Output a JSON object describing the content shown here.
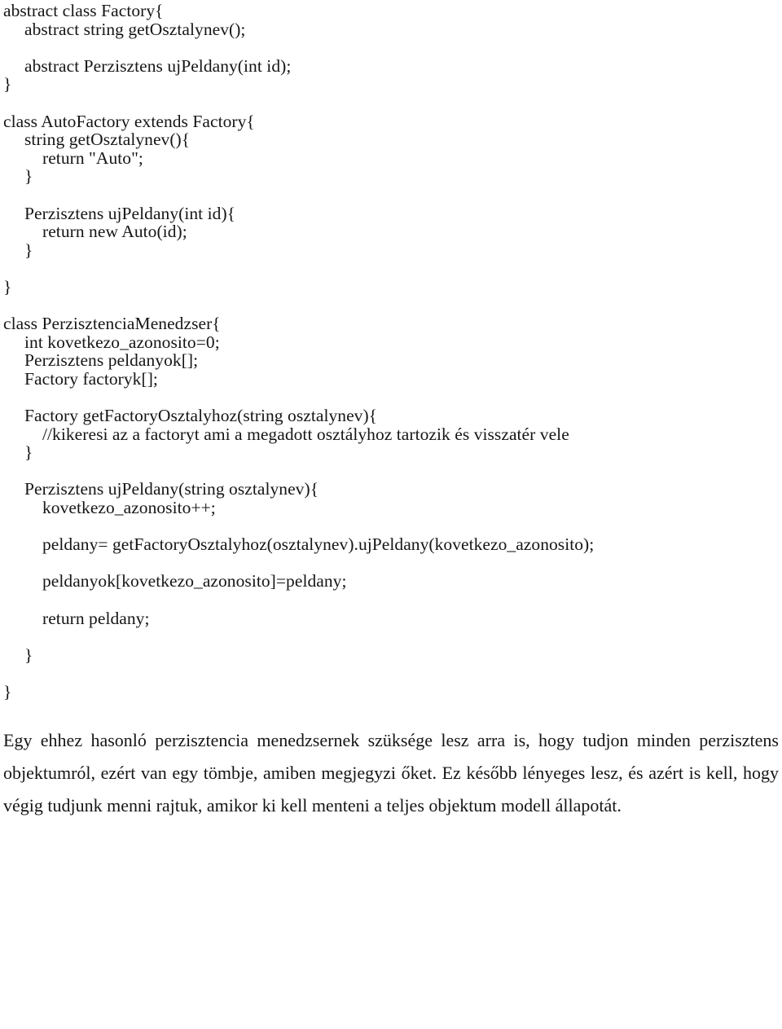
{
  "document": {
    "type": "scanned-text-page",
    "language": "hu",
    "background_color": "#ffffff",
    "text_color": "#161616"
  },
  "code_listing": {
    "language": "java-like pseudocode",
    "lines": [
      {
        "indent": 0,
        "text": "abstract class Factory{"
      },
      {
        "indent": 1,
        "text": "abstract string getOsztalynev();"
      },
      {
        "indent": 0,
        "text": ""
      },
      {
        "indent": 1,
        "text": "abstract Perzisztens ujPeldany(int id);"
      },
      {
        "indent": 0,
        "text": "}"
      },
      {
        "indent": 0,
        "text": ""
      },
      {
        "indent": 0,
        "text": "class AutoFactory extends Factory{"
      },
      {
        "indent": 1,
        "text": "string getOsztalynev(){"
      },
      {
        "indent": 2,
        "text": "return \"Auto\";"
      },
      {
        "indent": 1,
        "text": "}"
      },
      {
        "indent": 0,
        "text": ""
      },
      {
        "indent": 1,
        "text": "Perzisztens ujPeldany(int id){"
      },
      {
        "indent": 2,
        "text": "return new Auto(id);"
      },
      {
        "indent": 1,
        "text": "}"
      },
      {
        "indent": 0,
        "text": ""
      },
      {
        "indent": 0,
        "text": "}"
      },
      {
        "indent": 0,
        "text": ""
      },
      {
        "indent": 0,
        "text": "class PerzisztenciaMenedzser{"
      },
      {
        "indent": 1,
        "text": "int kovetkezo_azonosito=0;"
      },
      {
        "indent": 1,
        "text": "Perzisztens peldanyok[];"
      },
      {
        "indent": 1,
        "text": "Factory factoryk[];"
      },
      {
        "indent": 0,
        "text": ""
      },
      {
        "indent": 1,
        "text": "Factory getFactoryOsztalyhoz(string osztalynev){"
      },
      {
        "indent": 2,
        "text": "//kikeresi az a factoryt ami a megadott osztályhoz tartozik és visszatér vele"
      },
      {
        "indent": 1,
        "text": "}"
      },
      {
        "indent": 0,
        "text": ""
      },
      {
        "indent": 1,
        "text": "Perzisztens ujPeldany(string osztalynev){"
      },
      {
        "indent": 2,
        "text": "kovetkezo_azonosito++;"
      },
      {
        "indent": 0,
        "text": ""
      },
      {
        "indent": 2,
        "text": "peldany= getFactoryOsztalyhoz(osztalynev).ujPeldany(kovetkezo_azonosito);"
      },
      {
        "indent": 0,
        "text": ""
      },
      {
        "indent": 2,
        "text": "peldanyok[kovetkezo_azonosito]=peldany;"
      },
      {
        "indent": 0,
        "text": ""
      },
      {
        "indent": 2,
        "text": "return peldany;"
      },
      {
        "indent": 0,
        "text": ""
      },
      {
        "indent": 1,
        "text": "}"
      },
      {
        "indent": 0,
        "text": ""
      },
      {
        "indent": 0,
        "text": "}"
      }
    ]
  },
  "paragraph": {
    "text": "Egy ehhez hasonló perzisztencia menedzsernek szüksége lesz arra is, hogy tudjon minden perzisztens objektumról, ezért van egy tömbje, amiben megjegyzi őket. Ez később lényeges lesz, és azért is kell, hogy végig tudjunk menni rajtuk, amikor ki kell menteni a teljes objektum modell állapotát."
  }
}
